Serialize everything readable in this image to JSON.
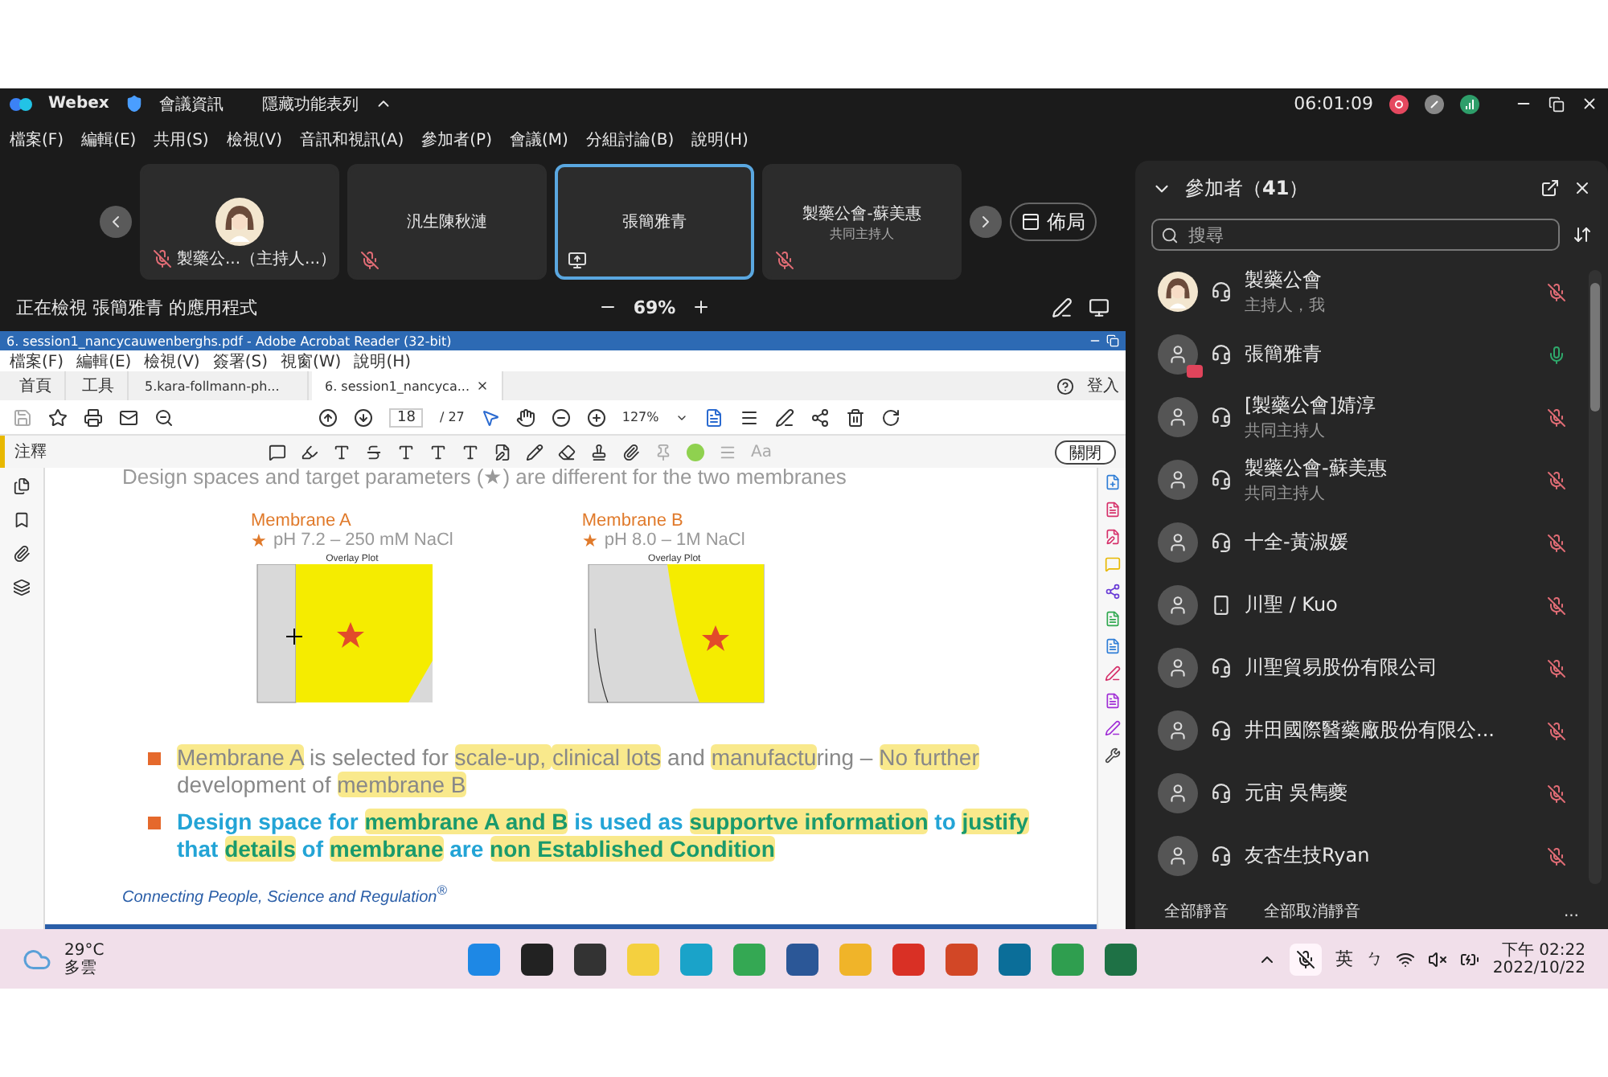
{
  "window": {
    "app_name": "Webex",
    "meeting_info": "會議資訊",
    "hide_menu": "隱藏功能表列",
    "timer": "06:01:09"
  },
  "menu": [
    "檔案(F)",
    "編輯(E)",
    "共用(S)",
    "檢視(V)",
    "音訊和視訊(A)",
    "參加者(P)",
    "會議(M)",
    "分組討論(B)",
    "說明(H)"
  ],
  "video_strip": {
    "tiles": [
      {
        "name": "製藥公...（主持人...）",
        "kind": "avatar",
        "muted": true,
        "sharing": false,
        "selected": false
      },
      {
        "name": "汎生陳秋漣",
        "kind": "plain",
        "muted": true,
        "sharing": false,
        "selected": false
      },
      {
        "name": "張簡雅青",
        "kind": "plain",
        "sharing": true,
        "selected": true
      },
      {
        "name": "製藥公會-蘇美惠",
        "role": "共同主持人",
        "kind": "plain",
        "muted": true,
        "sharing": false,
        "selected": false
      }
    ],
    "layout_button": "佈局"
  },
  "viewing_bar": {
    "label": "正在檢視 張簡雅青 的應用程式",
    "zoom": "69%"
  },
  "shared_app": {
    "title": "6. session1_nancycauwenberghs.pdf - Adobe Acrobat Reader (32-bit)",
    "menu": [
      "檔案(F)",
      "編輯(E)",
      "檢視(V)",
      "簽署(S)",
      "視窗(W)",
      "說明(H)"
    ],
    "tabs": [
      {
        "label": "首頁",
        "kind": "nav",
        "selected": false
      },
      {
        "label": "工具",
        "kind": "nav",
        "selected": false
      },
      {
        "label": "5.kara-follmann-ph...",
        "kind": "doc",
        "selected": false
      },
      {
        "label": "6. session1_nancyca...",
        "kind": "doc",
        "selected": true
      }
    ],
    "sign_in": "登入",
    "page": "18",
    "page_total": "/ 27",
    "zoom": "127%",
    "comment_label": "注釋",
    "font_label": "Aa",
    "close_button": "關閉",
    "document": {
      "cut_line": "Design spaces and target parameters (★) are different for the two membranes",
      "plots": [
        {
          "label": "Membrane A",
          "marker": "★",
          "condition": "pH 7.2 – 250 mM NaCl",
          "title": "Overlay Plot",
          "kind": "a"
        },
        {
          "label": "Membrane B",
          "marker": "★",
          "condition": "pH 8.0 – 1M NaCl",
          "title": "Overlay Plot",
          "kind": "b"
        }
      ],
      "bullets": [
        {
          "kind": "plain",
          "segments": [
            {
              "text": "Membrane A",
              "highlighted": true
            },
            {
              "text": " is selected for ",
              "highlighted": false
            },
            {
              "text": "scale-up, ",
              "highlighted": true
            },
            {
              "text": "clinical lots",
              "highlighted": true
            },
            {
              "text": " and ",
              "highlighted": false
            },
            {
              "text": "manufactu",
              "highlighted": true
            },
            {
              "text": "ring – ",
              "highlighted": false
            },
            {
              "text": "No further",
              "highlighted": true
            },
            {
              "text": " development of ",
              "highlighted": false
            },
            {
              "text": "membrane B",
              "highlighted": true
            }
          ]
        },
        {
          "kind": "emphasis",
          "segments": [
            {
              "text": "Design space for ",
              "highlighted": false
            },
            {
              "text": "membrane A and B",
              "highlighted": true
            },
            {
              "text": " is used as ",
              "highlighted": false
            },
            {
              "text": "supportve information",
              "highlighted": true
            },
            {
              "text": " to ",
              "highlighted": false
            },
            {
              "text": "justify",
              "highlighted": true
            },
            {
              "text": " that ",
              "highlighted": false
            },
            {
              "text": "details",
              "highlighted": true
            },
            {
              "text": " of ",
              "highlighted": false
            },
            {
              "text": "membrane",
              "highlighted": true
            },
            {
              "text": " are ",
              "highlighted": false
            },
            {
              "text": "non Established Condition",
              "highlighted": true
            }
          ]
        }
      ],
      "footer": "Connecting People, Science and Regulation$^{®}$"
    }
  },
  "participants": {
    "title": "參加者（**41**）",
    "search_placeholder": "搜尋",
    "people": [
      {
        "name": "製藥公會",
        "role": "主持人，我",
        "kind": "photo",
        "on_phone": false,
        "muted": true,
        "presenting": false
      },
      {
        "name": "張簡雅青",
        "kind": "default",
        "on_phone": false,
        "muted": false,
        "presenting": true
      },
      {
        "name": "[製藥公會]婧淳",
        "role": "共同主持人",
        "kind": "default",
        "on_phone": false,
        "muted": true,
        "presenting": false
      },
      {
        "name": "製藥公會-蘇美惠",
        "role": "共同主持人",
        "kind": "default",
        "on_phone": false,
        "muted": true,
        "presenting": false
      },
      {
        "name": "十全-黃淑媛",
        "kind": "default",
        "on_phone": false,
        "muted": true,
        "presenting": false
      },
      {
        "name": "川聖 / Kuo",
        "kind": "default",
        "on_phone": true,
        "muted": true,
        "presenting": false
      },
      {
        "name": "川聖貿易股份有限公司",
        "kind": "default",
        "on_phone": false,
        "muted": true,
        "presenting": false
      },
      {
        "name": "井田國際醫藥廠股份有限公...",
        "kind": "default",
        "on_phone": false,
        "muted": true,
        "presenting": false
      },
      {
        "name": "元宙 吳雋夔",
        "kind": "default",
        "on_phone": false,
        "muted": true,
        "presenting": false
      },
      {
        "name": "友杏生技Ryan",
        "kind": "default",
        "on_phone": false,
        "muted": true,
        "presenting": false
      }
    ],
    "mute_all": "全部靜音",
    "unmute_all": "全部取消靜音",
    "more": "..."
  },
  "taskbar": {
    "temperature": "29°C",
    "weather": "多雲",
    "apps": [
      {
        "color": "#1e88e5"
      },
      {
        "color": "#222222"
      },
      {
        "color": "#333333"
      },
      {
        "color": "#f4d03f"
      },
      {
        "color": "#1aa3c9"
      },
      {
        "color": "#34a853"
      },
      {
        "color": "#2b5797"
      },
      {
        "color": "#f0b429"
      },
      {
        "color": "#d93025"
      },
      {
        "color": "#d24726"
      },
      {
        "color": "#0b6e99"
      },
      {
        "color": "#2f9e4f"
      },
      {
        "color": "#1e7145"
      }
    ],
    "input_lang": "英",
    "input_mode": "ㄅ",
    "time": "下午 02:22",
    "date": "2022/10/22"
  }
}
